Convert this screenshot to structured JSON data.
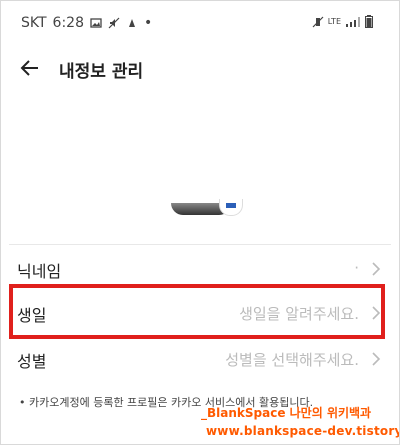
{
  "status_bar": {
    "carrier": "SKT",
    "time": "6:28",
    "network": "LTE"
  },
  "header": {
    "title": "내정보 관리"
  },
  "rows": [
    {
      "label": "닉네임",
      "value": "·"
    },
    {
      "label": "생일",
      "value": "생일을 알려주세요."
    },
    {
      "label": "성별",
      "value": "성별을 선택해주세요."
    }
  ],
  "note": "• 카카오계정에 등록한 프로필은 카카오 서비스에서 활용됩니다.",
  "watermark": {
    "line1": "_BlankSpace 나만의 위키백과",
    "line2": "www.blankspace-dev.tistory.com"
  },
  "colors": {
    "highlight": "#e0201c",
    "watermark": "#ff5a00",
    "value_text": "#bbbbbb"
  }
}
